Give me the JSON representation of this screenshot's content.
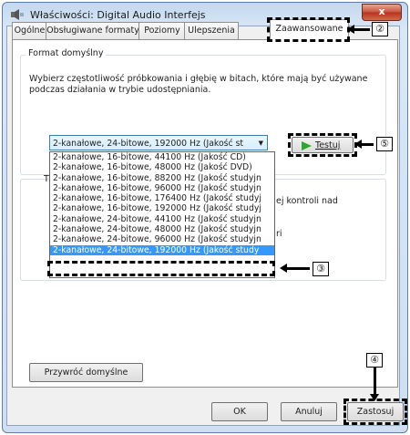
{
  "window": {
    "title": "Właściwości: Digital Audio Interfejs",
    "close_glyph": "x"
  },
  "tabs": [
    "Ogólne",
    "Obsługiwane formaty",
    "Poziomy",
    "Ulepszenia",
    "Zaawansowane"
  ],
  "format_group": {
    "legend": "Format domyślny",
    "description": "Wybierz częstotliwość próbkowania i głębię w bitach, które mają być używane podczas działania w trybie udostępniania.",
    "selected_value": "2-kanałowe, 24-bitowe, 192000 Hz (Jakość st",
    "test_button": "Testuj",
    "options": [
      "2-kanałowe, 16-bitowe, 44100 Hz (Jakość CD)",
      "2-kanałowe, 16-bitowe, 48000 Hz (Jakość DVD)",
      "2-kanałowe, 16-bitowe, 88200 Hz (Jakość studyjn",
      "2-kanałowe, 16-bitowe, 96000 Hz (Jakość studyjn",
      "2-kanałowe, 16-bitowe, 176400 Hz (Jakość studyj",
      "2-kanałowe, 16-bitowe, 192000 Hz (Jakość studyj",
      "2-kanałowe, 24-bitowe, 44100 Hz (Jakość studyjn",
      "2-kanałowe, 24-bitowe, 48000 Hz (Jakość studyjn",
      "2-kanałowe, 24-bitowe, 96000 Hz (Jakość studyjn",
      "2-kanałowe, 24-bitowe, 192000 Hz (Jakość study"
    ],
    "selected_index": 9
  },
  "hidden_fragments": {
    "letter": "T",
    "text_right": "ej kontroli nad",
    "text_ri": "ri"
  },
  "restore_button": "Przywróć domyślne",
  "buttons": {
    "ok": "OK",
    "cancel": "Anuluj",
    "apply": "Zastosuj"
  },
  "callouts": {
    "tab": "②",
    "list_item": "③",
    "apply": "④",
    "test": "⑤"
  },
  "colors": {
    "selection": "#3399ff",
    "play": "#2da82d",
    "close": "#c9523e"
  }
}
